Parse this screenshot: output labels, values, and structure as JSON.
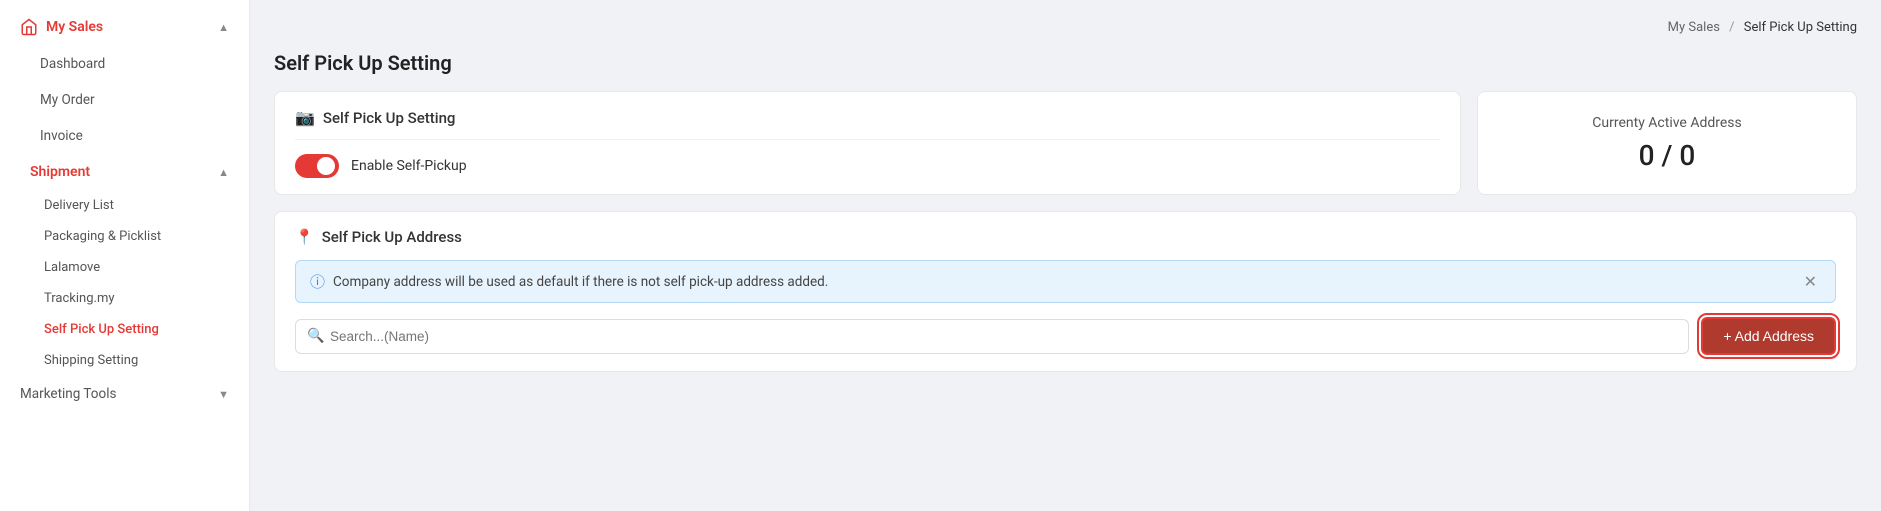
{
  "sidebar": {
    "my_sales_label": "My Sales",
    "items": [
      {
        "label": "Dashboard",
        "active": false,
        "id": "dashboard"
      },
      {
        "label": "My Order",
        "active": false,
        "id": "my-order"
      },
      {
        "label": "Invoice",
        "active": false,
        "id": "invoice"
      }
    ],
    "shipment": {
      "label": "Shipment",
      "active": true,
      "sub_items": [
        {
          "label": "Delivery List",
          "active": false,
          "id": "delivery-list"
        },
        {
          "label": "Packaging & Picklist",
          "active": false,
          "id": "packaging"
        },
        {
          "label": "Lalamove",
          "active": false,
          "id": "lalamove"
        },
        {
          "label": "Tracking.my",
          "active": false,
          "id": "tracking"
        },
        {
          "label": "Self Pick Up Setting",
          "active": true,
          "id": "self-pickup"
        },
        {
          "label": "Shipping Setting",
          "active": false,
          "id": "shipping-setting"
        }
      ]
    },
    "marketing_tools_label": "Marketing Tools"
  },
  "breadcrumb": {
    "parent": "My Sales",
    "separator": "/",
    "current": "Self Pick Up Setting"
  },
  "page_title": "Self Pick Up Setting",
  "setting_card": {
    "title": "Self Pick Up Setting",
    "toggle_label": "Enable Self-Pickup",
    "toggle_enabled": true
  },
  "active_address_card": {
    "label": "Currenty Active Address",
    "value": "0 / 0"
  },
  "address_section": {
    "title": "Self Pick Up Address",
    "info_message": "Company address will be used as default if there is not self pick-up address added.",
    "search_placeholder": "Search...(Name)",
    "add_button_label": "+ Add Address"
  }
}
